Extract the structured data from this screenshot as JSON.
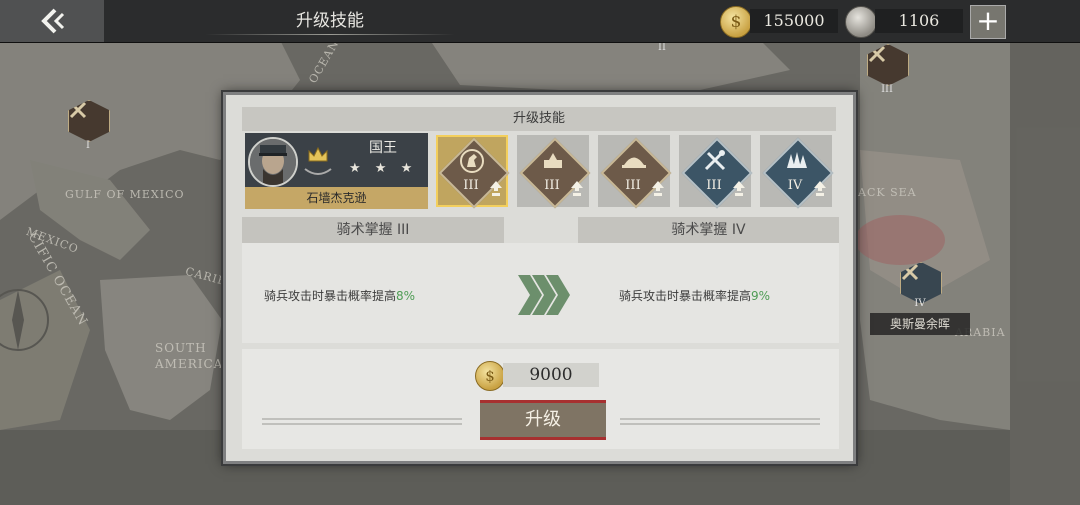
{
  "header": {
    "title": "升级技能"
  },
  "currency": {
    "gold": "155000",
    "silver": "1106",
    "plus_label": "+"
  },
  "map": {
    "labels": {
      "gulf": "GULF OF MEXICO",
      "mexico": "MEXICO",
      "south_america": "SOUTH\nAMERICA",
      "pacific": "CIFIC OCEAN",
      "ocean": "OCEAN",
      "caribbean": "CARIB",
      "black_sea": "ACK SEA",
      "arabia": "ARABIA"
    },
    "badges": [
      {
        "id": "left",
        "level": "I"
      },
      {
        "id": "top",
        "level": "II"
      },
      {
        "id": "right",
        "level": "III"
      },
      {
        "id": "ottoman",
        "level": "IV"
      }
    ],
    "ottoman_label": "奥斯曼余晖"
  },
  "dialog": {
    "title": "升级技能",
    "general": {
      "rank": "国王",
      "stars": "★ ★ ★",
      "name": "石墙杰克逊"
    },
    "skills": [
      {
        "level": "III",
        "icon": "horse-icon",
        "selected": true
      },
      {
        "level": "III",
        "icon": "tent-icon",
        "selected": false
      },
      {
        "level": "III",
        "icon": "helmet-icon",
        "selected": false
      },
      {
        "level": "III",
        "icon": "crossed-tools-icon",
        "selected": false
      },
      {
        "level": "IV",
        "icon": "trees-icon",
        "selected": false
      }
    ],
    "current": {
      "header": "骑术掌握 III",
      "desc": "骑兵攻击时暴击概率提高",
      "value": "8%"
    },
    "next": {
      "header": "骑术掌握 IV",
      "desc": "骑兵攻击时暴击概率提高",
      "value": "9%"
    },
    "cost": "9000",
    "upgrade_label": "升级"
  },
  "colors": {
    "gold_button_border": "#f3cf5c",
    "increase_green": "#4e9c54",
    "button_red": "#a73030"
  }
}
